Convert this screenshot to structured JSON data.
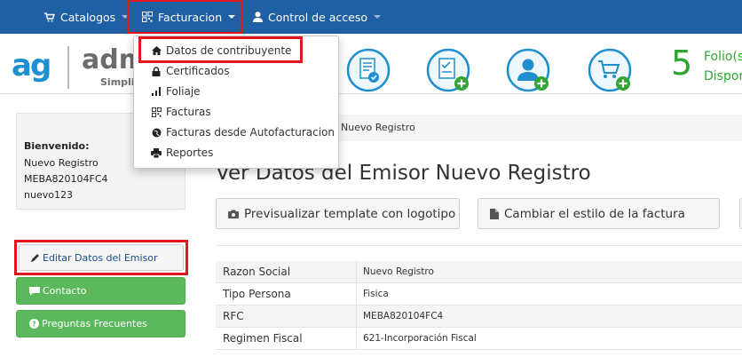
{
  "navbar": {
    "catalogos": "Catalogos",
    "facturacion": "Facturacion",
    "control_acceso": "Control de acceso"
  },
  "dropdown": {
    "items": [
      {
        "label": "Datos de contribuyente",
        "icon": "home-icon"
      },
      {
        "label": "Certificados",
        "icon": "lock-icon"
      },
      {
        "label": "Foliaje",
        "icon": "signal-bars-icon"
      },
      {
        "label": "Facturas",
        "icon": "qrcode-icon"
      },
      {
        "label": "Facturas desde Autofacturacion",
        "icon": "globe-icon"
      },
      {
        "label": "Reportes",
        "icon": "print-icon"
      }
    ]
  },
  "header": {
    "logo_ag": "ag",
    "logo_adm": "adm",
    "logo_tagline": "Simplif",
    "folio_count": "5",
    "folio_label1": "Folio(s",
    "folio_label2": "Dispor"
  },
  "sidebar": {
    "welcome_title": "Bienvenido:",
    "user_name": "Nuevo Registro",
    "user_rfc": "MEBA820104FC4",
    "username": "nuevo123",
    "editar_label": "Editar Datos del Emisor",
    "contacto_label": "Contacto",
    "preguntas_label": "Preguntas Frecuentes"
  },
  "main": {
    "breadcrumb": "Nuevo Registro",
    "title": "Ver Datos del Emisor Nuevo Registro",
    "btn_preview": "Previsualizar template con logotipo",
    "btn_estilo": "Cambiar el estilo de la factura",
    "rows": [
      {
        "key": "Razon Social",
        "value": "Nuevo Registro"
      },
      {
        "key": "Tipo Persona",
        "value": "Fisica"
      },
      {
        "key": "RFC",
        "value": "MEBA820104FC4"
      },
      {
        "key": "Regimen Fiscal",
        "value": "621-Incorporación Fiscal"
      }
    ]
  },
  "colors": {
    "navbar": "#1f5fa4",
    "highlight": "#e2161d",
    "green_button": "#5cb85c",
    "folio_green": "#2fa62f",
    "logo_blue": "#1f8fcf"
  }
}
